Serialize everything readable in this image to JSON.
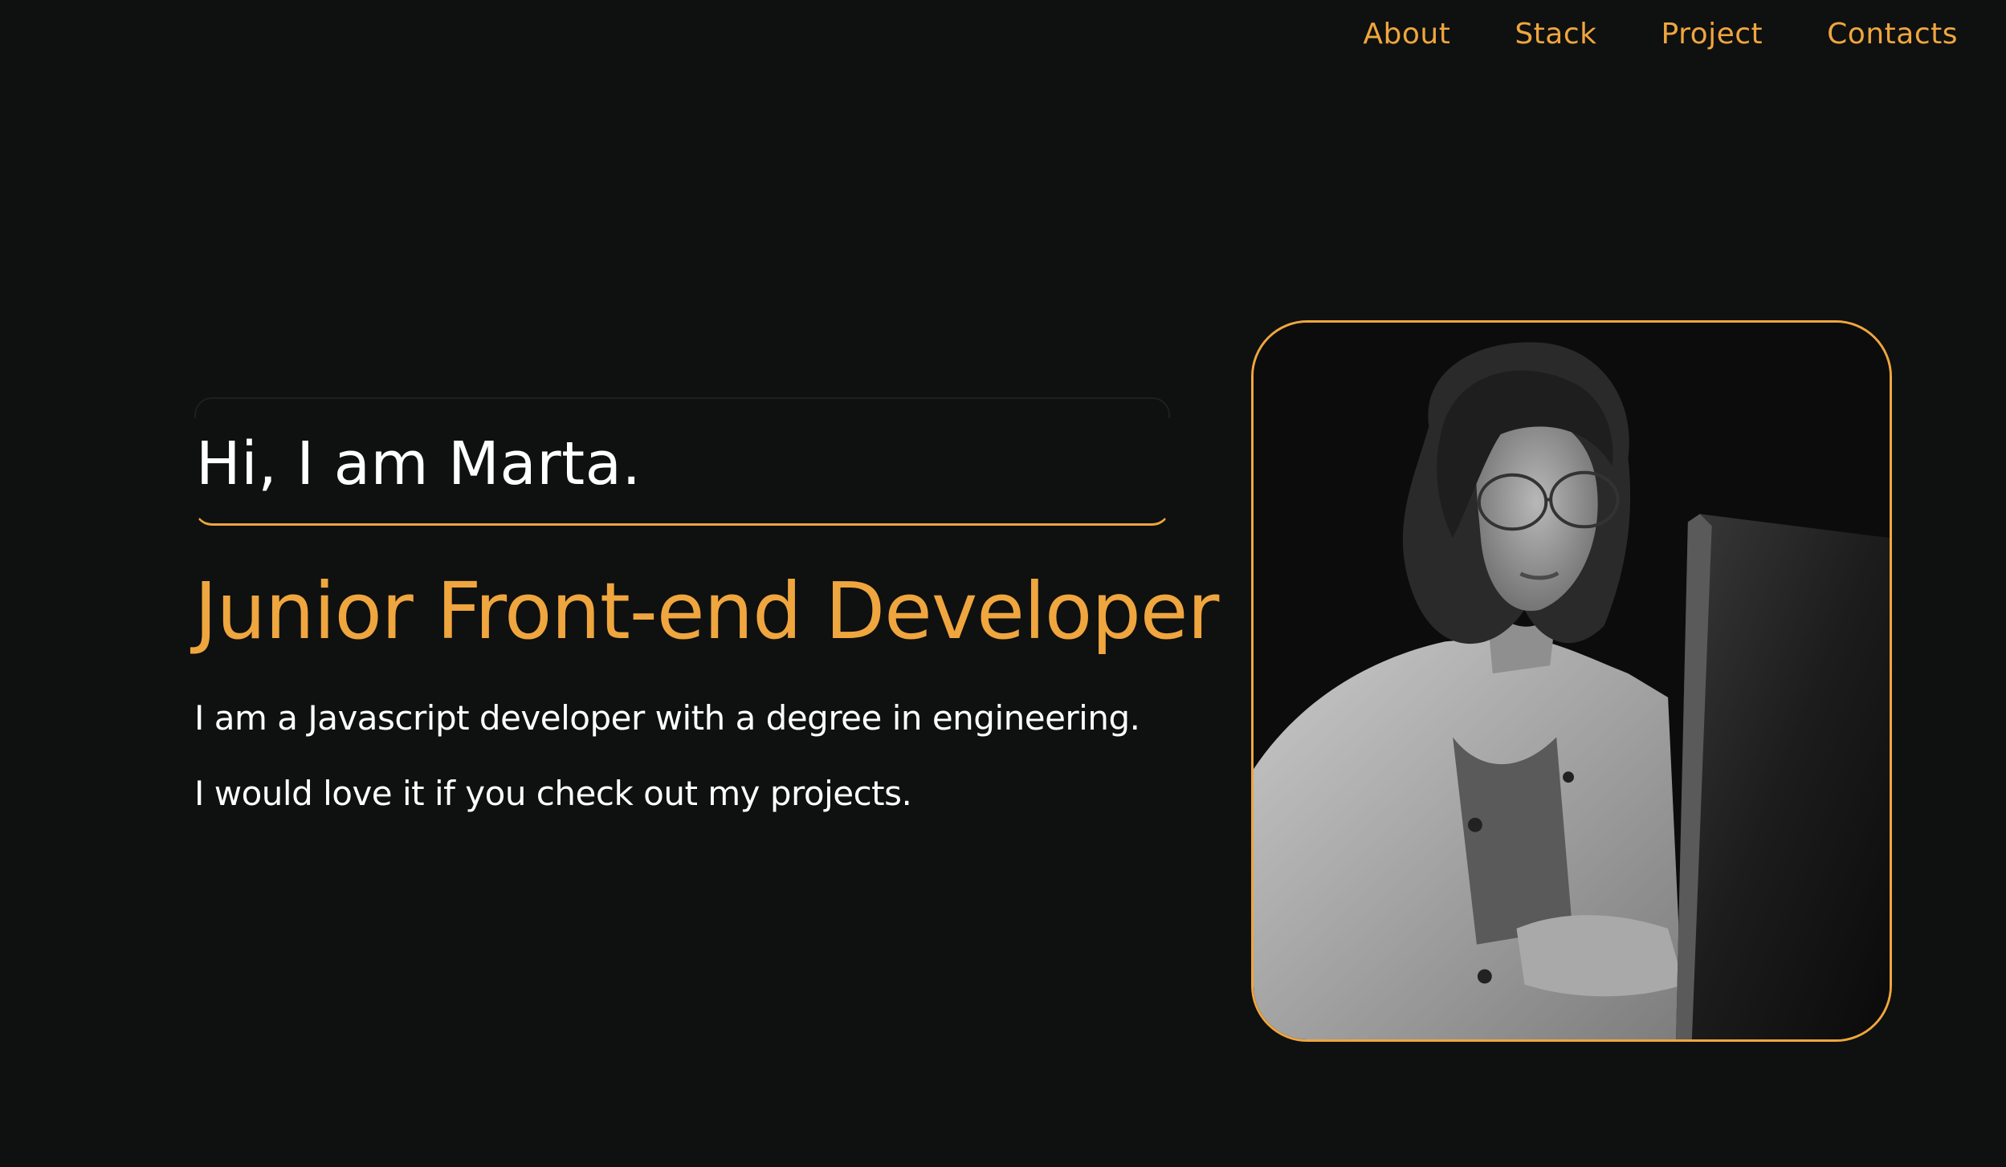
{
  "nav": {
    "items": [
      {
        "label": "About"
      },
      {
        "label": "Stack"
      },
      {
        "label": "Project"
      },
      {
        "label": "Contacts"
      }
    ]
  },
  "hero": {
    "greeting": "Hi, I am Marta.",
    "role": "Junior Front-end Developer",
    "description_1": "I am a Javascript developer with a degree in engineering.",
    "description_2": "I would love it if you check out my projects.",
    "photo": {
      "subject": "portrait-of-developer-at-laptop",
      "style": "black-and-white"
    }
  },
  "colors": {
    "background": "#0f1010",
    "accent": "#efa63e",
    "text": "#ffffff"
  }
}
